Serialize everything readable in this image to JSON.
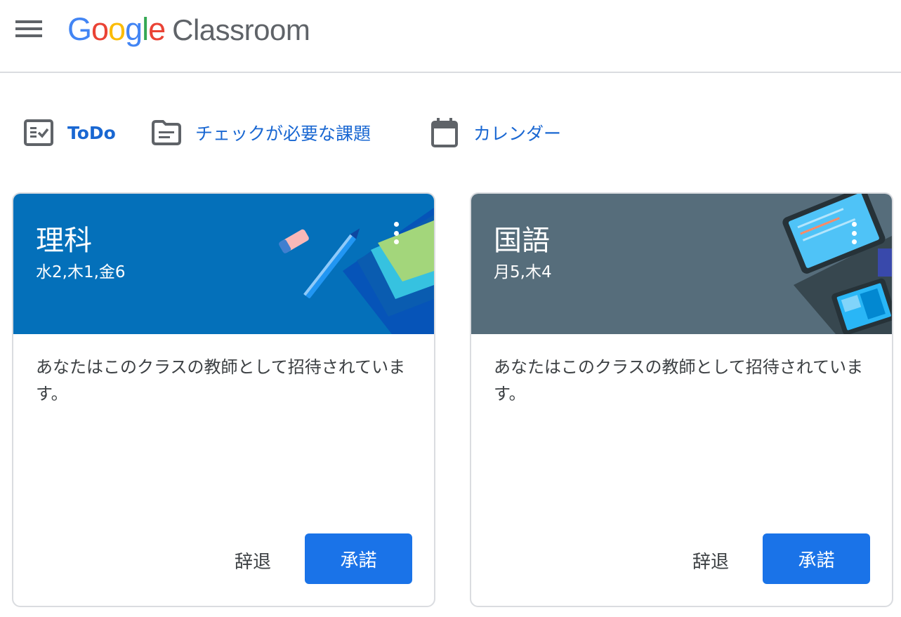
{
  "app": {
    "logo_letters": [
      "G",
      "o",
      "o",
      "g",
      "l",
      "e"
    ],
    "logo_colors": [
      "#4285f4",
      "#ea4335",
      "#fbbc05",
      "#4285f4",
      "#34a853",
      "#ea4335"
    ],
    "product_name": "Classroom",
    "menu_icon": "hamburger-menu-icon"
  },
  "nav": {
    "items": [
      {
        "label": "ToDo",
        "icon": "todo-checklist-icon"
      },
      {
        "label": "チェックが必要な課題",
        "icon": "folder-review-icon"
      },
      {
        "label": "カレンダー",
        "icon": "calendar-icon"
      }
    ],
    "color": "#1967d2"
  },
  "cards": [
    {
      "title": "理科",
      "section": "水2,木1,金6",
      "banner_color": "#0470ba",
      "message": "あなたはこのクラスの教師として招待されています。",
      "decline_label": "辞退",
      "accept_label": "承諾",
      "menu_icon": "more-vert-icon"
    },
    {
      "title": "国語",
      "section": "月5,木4",
      "banner_color": "#566d7b",
      "message": "あなたはこのクラスの教師として招待されています。",
      "decline_label": "辞退",
      "accept_label": "承諾",
      "menu_icon": "more-vert-icon"
    }
  ],
  "accent_color": "#1a73e8"
}
